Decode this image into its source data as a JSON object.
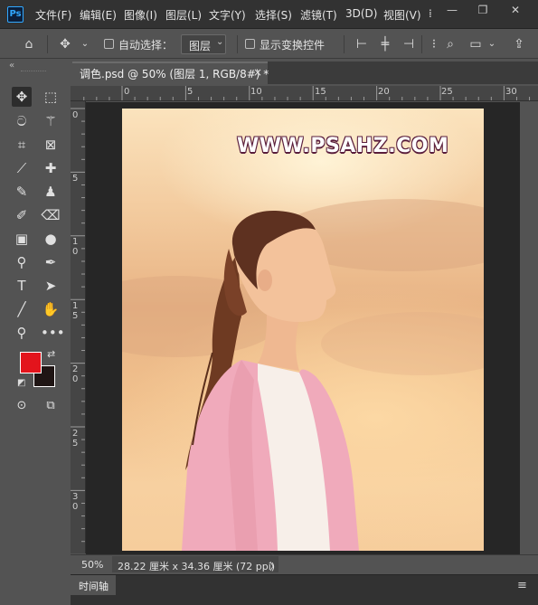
{
  "app": {
    "logo": "Ps"
  },
  "menu": [
    "文件(F)",
    "编辑(E)",
    "图像(I)",
    "图层(L)",
    "文字(Y)",
    "选择(S)",
    "滤镜(T)",
    "3D(D)",
    "视图(V)"
  ],
  "window_controls": {
    "minimize": "—",
    "restore": "❐",
    "close": "✕"
  },
  "options_bar": {
    "auto_select_label": "自动选择：",
    "layer_select_value": "图层",
    "show_transform_label": "显示变换控件"
  },
  "document": {
    "tab_title": "调色.psd @ 50% (图层 1, RGB/8#) *",
    "close": "×"
  },
  "ruler_h": [
    "0",
    "5",
    "10",
    "15",
    "20",
    "25",
    "30"
  ],
  "ruler_v": [
    "0",
    "5",
    "1\n0",
    "1\n5",
    "2\n0",
    "2\n5",
    "3\n0"
  ],
  "canvas": {
    "watermark": "WWW.PSAHZ.COM"
  },
  "status": {
    "zoom": "50%",
    "doc_info": "28.22 厘米 x 34.36 厘米 (72 ppi)",
    "arrow": "〉"
  },
  "timeline": {
    "label": "时间轴",
    "menu_icon": "≡"
  },
  "colors": {
    "foreground": "#e3141c",
    "background": "#1f1514"
  }
}
